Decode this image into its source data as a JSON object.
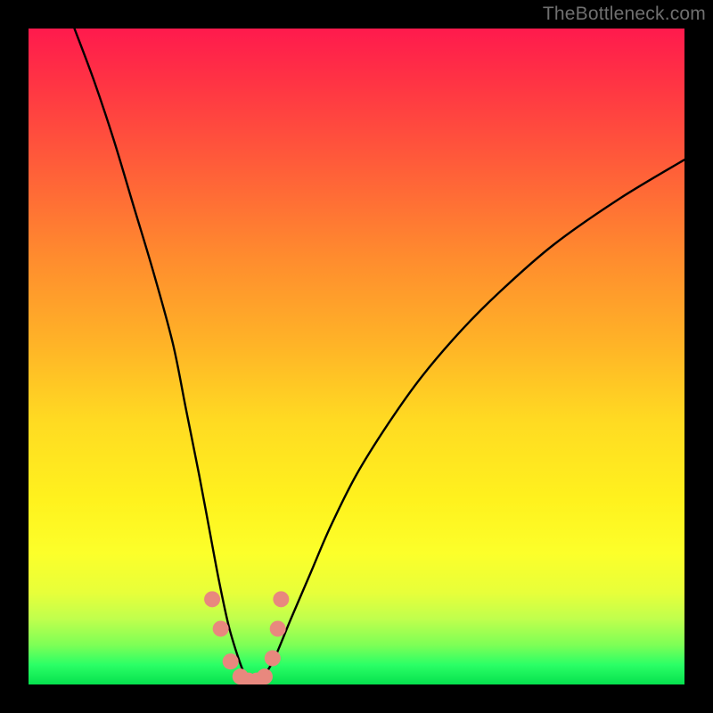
{
  "watermark": "TheBottleneck.com",
  "chart_data": {
    "type": "line",
    "title": "",
    "xlabel": "",
    "ylabel": "",
    "xlim": [
      0,
      100
    ],
    "ylim": [
      0,
      100
    ],
    "series": [
      {
        "name": "curve",
        "color": "#000000",
        "x": [
          7,
          10,
          13,
          16,
          19,
          22,
          24,
          26,
          27.5,
          29,
          30.5,
          32,
          33,
          34,
          35,
          36,
          37.5,
          40,
          43,
          46,
          50,
          55,
          60,
          66,
          72,
          80,
          90,
          100
        ],
        "y": [
          100,
          92,
          83,
          73,
          63,
          52,
          42,
          32,
          24,
          16,
          9,
          4,
          1.5,
          0.5,
          0.5,
          1.5,
          4,
          10,
          17,
          24,
          32,
          40,
          47,
          54,
          60,
          67,
          74,
          80
        ]
      },
      {
        "name": "marker-cluster",
        "color": "#e8887e",
        "type": "scatter",
        "x": [
          28.0,
          29.3,
          30.8,
          32.3,
          33.5,
          34.8,
          36.0,
          37.2,
          38.0,
          38.5
        ],
        "y": [
          13.0,
          8.5,
          3.5,
          1.2,
          0.6,
          0.6,
          1.2,
          4.0,
          8.5,
          13.0
        ]
      }
    ],
    "gradient_colors": {
      "top": "#ff1a4d",
      "mid_upper": "#ff8c2e",
      "mid": "#fff21e",
      "bottom": "#06e14e"
    }
  }
}
